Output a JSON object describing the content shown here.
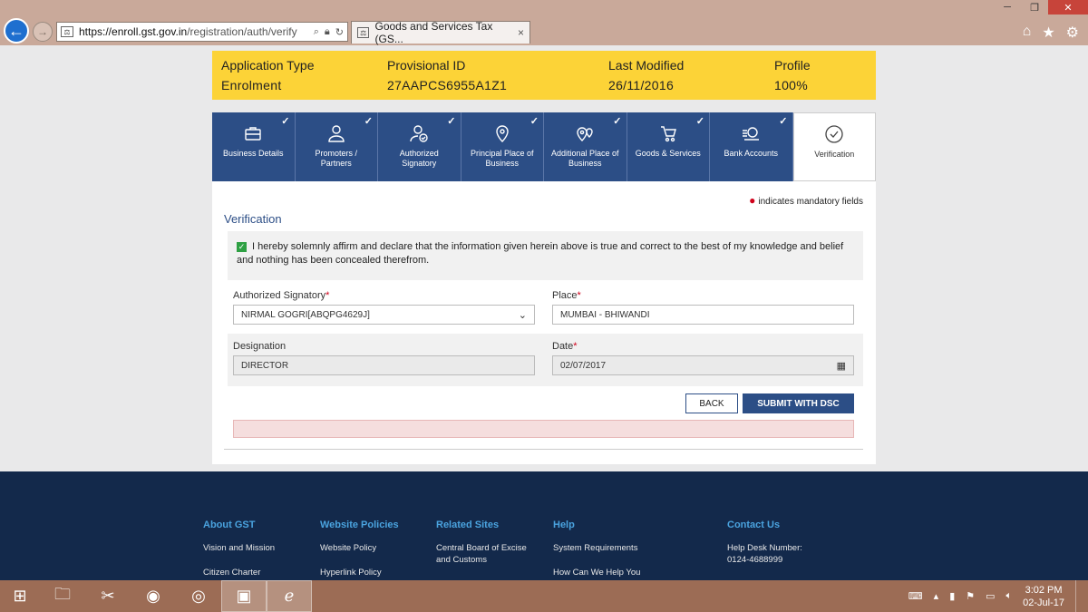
{
  "browser": {
    "url_host": "https://enroll.gst.gov.in",
    "url_path": "/registration/auth/verify",
    "tab_title": "Goods and Services Tax (GS...",
    "tab_close": "×"
  },
  "info": {
    "app_type_label": "Application Type",
    "app_type_value": "Enrolment",
    "prov_id_label": "Provisional ID",
    "prov_id_value": "27AAPCS6955A1Z1",
    "modified_label": "Last Modified",
    "modified_value": "26/11/2016",
    "profile_label": "Profile",
    "profile_value": "100%"
  },
  "steps": [
    {
      "label": "Business Details",
      "icon": "briefcase-icon"
    },
    {
      "label": "Promoters / Partners",
      "icon": "person-icon"
    },
    {
      "label": "Authorized Signatory",
      "icon": "person-check-icon"
    },
    {
      "label": "Principal Place of Business",
      "icon": "location-pin-icon"
    },
    {
      "label": "Additional Place of Business",
      "icon": "multi-pin-icon"
    },
    {
      "label": "Goods & Services",
      "icon": "cart-icon"
    },
    {
      "label": "Bank Accounts",
      "icon": "bank-icon"
    },
    {
      "label": "Verification",
      "icon": "check-circle-icon"
    }
  ],
  "form": {
    "mandatory_note": "indicates mandatory fields",
    "section_title": "Verification",
    "declaration": "I hereby solemnly affirm and declare that the information given herein above is true and correct to the best of my knowledge and belief and nothing has been concealed therefrom.",
    "signatory_label": "Authorized Signatory",
    "signatory_value": "NIRMAL GOGRI[ABQPG4629J]",
    "place_label": "Place",
    "place_value": "MUMBAI - BHIWANDI",
    "designation_label": "Designation",
    "designation_value": "DIRECTOR",
    "date_label": "Date",
    "date_value": "02/07/2017",
    "back_label": "BACK",
    "submit_label": "SUBMIT WITH DSC",
    "required_mark": "*"
  },
  "footer": {
    "col1": {
      "title": "About GST",
      "links": [
        "Vision and Mission",
        "Citizen Charter"
      ]
    },
    "col2": {
      "title": "Website Policies",
      "links": [
        "Website Policy",
        "Hyperlink Policy"
      ]
    },
    "col3": {
      "title": "Related Sites",
      "links": [
        "Central Board of Excise and Customs"
      ]
    },
    "col4": {
      "title": "Help",
      "links": [
        "System Requirements",
        "How Can We Help You"
      ]
    },
    "col5": {
      "title": "Contact Us",
      "links": [
        "Help Desk Number:",
        "0124-4688999"
      ]
    }
  },
  "taskbar": {
    "time": "3:02 PM",
    "date": "02-Jul-17"
  },
  "colors": {
    "primary": "#2c4e86",
    "infobar": "#fcd337",
    "footer": "#13294b",
    "footer_heading": "#4aa3df",
    "required": "#d0021b"
  }
}
